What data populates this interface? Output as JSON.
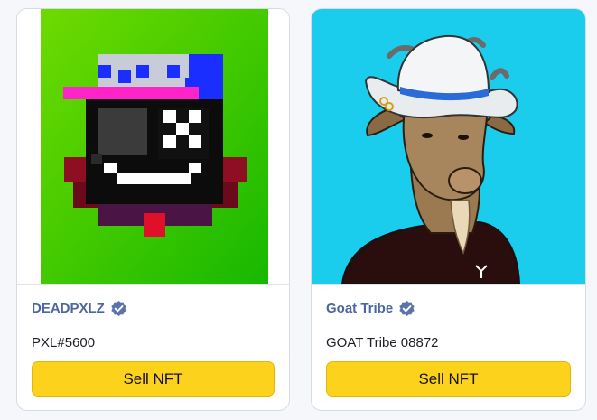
{
  "colors": {
    "accent": "#fcd21c",
    "collection_text": "#4c66a0",
    "verified_badge": "#5b73ad"
  },
  "cards": [
    {
      "collection": "DEADPXLZ",
      "verified_icon": "verified-badge-icon",
      "token_name": "PXL#5600",
      "sell_label": "Sell NFT",
      "image_bg": "#22c400"
    },
    {
      "collection": "Goat Tribe",
      "verified_icon": "verified-badge-icon",
      "token_name": "GOAT Tribe 08872",
      "sell_label": "Sell NFT",
      "image_bg": "#1bcdec"
    }
  ]
}
